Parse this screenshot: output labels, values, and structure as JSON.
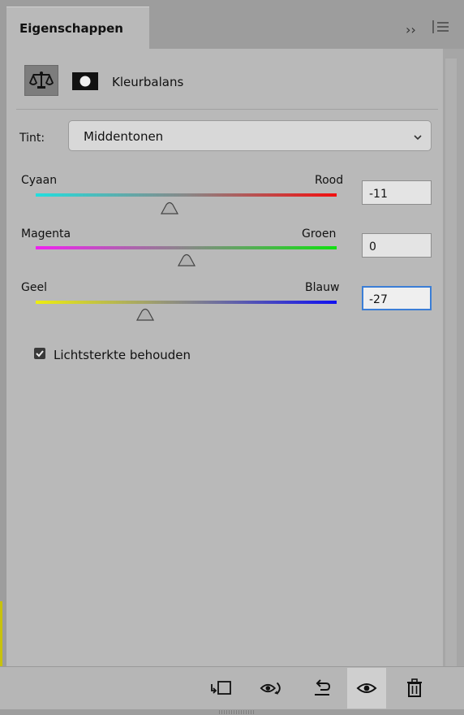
{
  "panel": {
    "tab_label": "Eigenschappen",
    "expand_icon": "double-chevron-right-icon",
    "menu_icon": "hamburger-menu-icon"
  },
  "adjustment": {
    "icon": "balance-scale-icon",
    "mask_icon": "layer-mask-icon",
    "title": "Kleurbalans"
  },
  "tint": {
    "label": "Tint:",
    "selected": "Middentonen",
    "icon": "chevron-down-icon"
  },
  "sliders": [
    {
      "left_label": "Cyaan",
      "right_label": "Rood",
      "value": "-11",
      "range": [
        -100,
        100
      ],
      "gradient": [
        "#22dede",
        "#f20f0f"
      ],
      "active": false
    },
    {
      "left_label": "Magenta",
      "right_label": "Groen",
      "value": "0",
      "range": [
        -100,
        100
      ],
      "gradient": [
        "#f020f0",
        "#10e010"
      ],
      "active": false
    },
    {
      "left_label": "Geel",
      "right_label": "Blauw",
      "value": "-27",
      "range": [
        -100,
        100
      ],
      "gradient": [
        "#eded10",
        "#1010f0"
      ],
      "active": true
    }
  ],
  "preserve_luminosity": {
    "label": "Lichtsterkte behouden",
    "checked": true
  },
  "footer": {
    "buttons": [
      {
        "icon": "clip-to-layer-icon",
        "active": false
      },
      {
        "icon": "view-previous-state-icon",
        "active": false
      },
      {
        "icon": "reset-icon",
        "active": false
      },
      {
        "icon": "toggle-visibility-eye-icon",
        "active": true
      },
      {
        "icon": "trash-icon",
        "active": false
      }
    ]
  },
  "colors": {
    "panel_bg": "#b9b9b9",
    "focus_border": "#3b7ed6"
  }
}
